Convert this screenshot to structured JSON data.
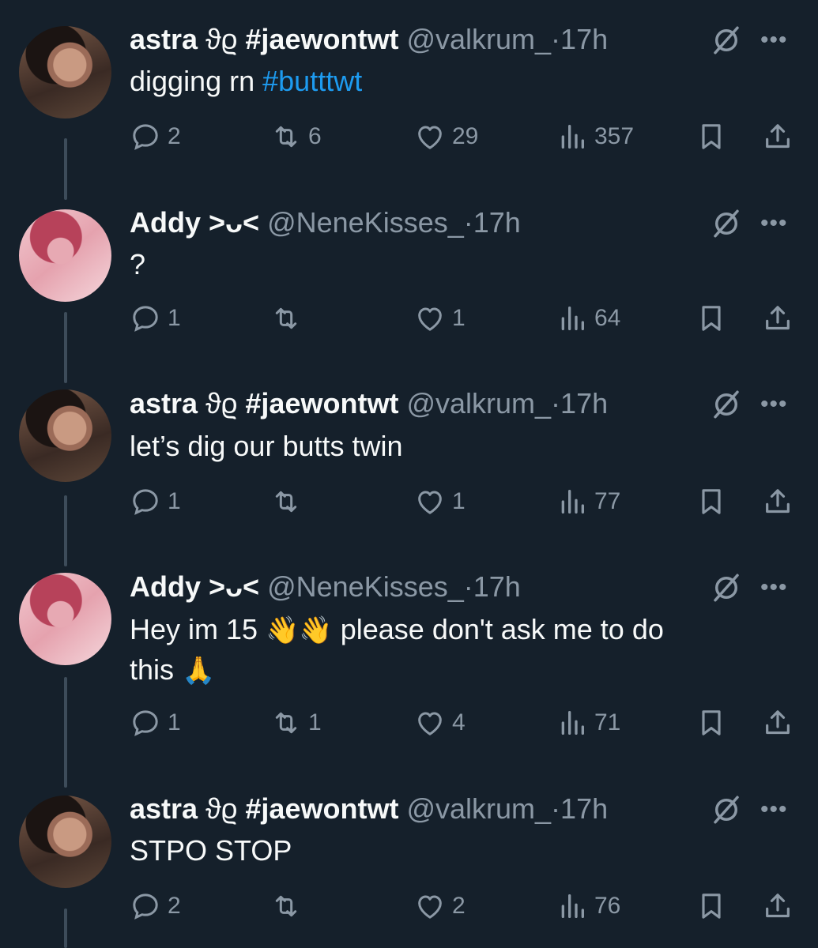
{
  "tweets": [
    {
      "name": "astra",
      "symbol": "ϑϱ",
      "name_tag": "#jaewontwt",
      "handle": "@valkrum_",
      "time": "17h",
      "text": "digging rn ",
      "hashtag": "#butttwt",
      "replies": "2",
      "retweets": "6",
      "likes": "29",
      "views": "357"
    },
    {
      "name": "Addy",
      "symbol": "˃ᴗ˂",
      "handle": "@NeneKisses_",
      "time": "17h",
      "text": "?",
      "replies": "1",
      "retweets": "",
      "likes": "1",
      "views": "64"
    },
    {
      "name": "astra",
      "symbol": "ϑϱ",
      "name_tag": "#jaewontwt",
      "handle": "@valkrum_",
      "time": "17h",
      "text": "let’s dig our butts twin",
      "replies": "1",
      "retweets": "",
      "likes": "1",
      "views": "77"
    },
    {
      "name": "Addy",
      "symbol": "˃ᴗ˂",
      "handle": "@NeneKisses_",
      "time": "17h",
      "text_line1_a": "Hey im 15 ",
      "emoji_wave": "👋👋",
      "text_line1_b": " please don't ask me to do",
      "text_line2": "this ",
      "emoji_pray": "🙏",
      "replies": "1",
      "retweets": "1",
      "likes": "4",
      "views": "71"
    },
    {
      "name": "astra",
      "symbol": "ϑϱ",
      "name_tag": "#jaewontwt",
      "handle": "@valkrum_",
      "time": "17h",
      "text": "STPO STOP",
      "replies": "2",
      "retweets": "",
      "likes": "2",
      "views": "76"
    }
  ],
  "separator": "·",
  "more_icon": "•••",
  "colors": {
    "background": "#15202b",
    "text": "#f7f9f9",
    "secondary": "#8b98a5",
    "link": "#1d9bf0"
  },
  "icons": [
    "reply-icon",
    "retweet-icon",
    "like-icon",
    "views-icon",
    "bookmark-icon",
    "share-icon",
    "grok-icon",
    "more-icon"
  ]
}
